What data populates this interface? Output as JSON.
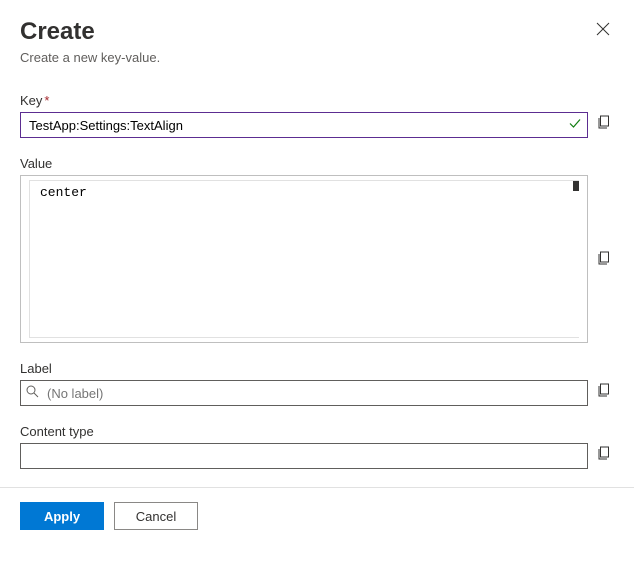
{
  "header": {
    "title": "Create",
    "subtitle": "Create a new key-value."
  },
  "fields": {
    "key": {
      "label": "Key",
      "value": "TestApp:Settings:TextAlign",
      "required_marker": "*"
    },
    "value": {
      "label": "Value",
      "value": "center"
    },
    "label_field": {
      "label": "Label",
      "placeholder": "(No label)"
    },
    "content_type": {
      "label": "Content type",
      "value": ""
    }
  },
  "buttons": {
    "apply": "Apply",
    "cancel": "Cancel"
  }
}
